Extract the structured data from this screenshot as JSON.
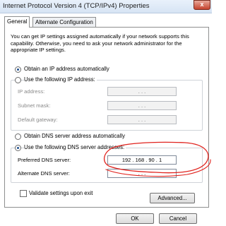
{
  "window": {
    "title": "Internet Protocol Version 4 (TCP/IPv4) Properties",
    "close_glyph": "x"
  },
  "tabs": [
    {
      "label": "General"
    },
    {
      "label": "Alternate Configuration"
    }
  ],
  "general": {
    "intro": "You can get IP settings assigned automatically if your network supports this capability. Otherwise, you need to ask your network administrator for the appropriate IP settings.",
    "ip_auto_label": "Obtain an IP address automatically",
    "ip_manual_label": "Use the following IP address:",
    "ip_address_label": "IP address:",
    "ip_address_value": ".     .     .",
    "subnet_label": "Subnet mask:",
    "subnet_value": ".     .     .",
    "gateway_label": "Default gateway:",
    "gateway_value": ".     .     .",
    "dns_auto_label": "Obtain DNS server address automatically",
    "dns_manual_label": "Use the following DNS server addresses:",
    "preferred_dns_label": "Preferred DNS server:",
    "preferred_dns_value": "192 . 168 . 90  .  1",
    "alternate_dns_label": "Alternate DNS server:",
    "alternate_dns_value": ".     .     .",
    "validate_label": "Validate settings upon exit",
    "advanced_label": "Advanced..."
  },
  "footer": {
    "ok_label": "OK",
    "cancel_label": "Cancel"
  },
  "colors": {
    "annotation": "#e0231e",
    "selected_radio": "#1e4e8c"
  }
}
